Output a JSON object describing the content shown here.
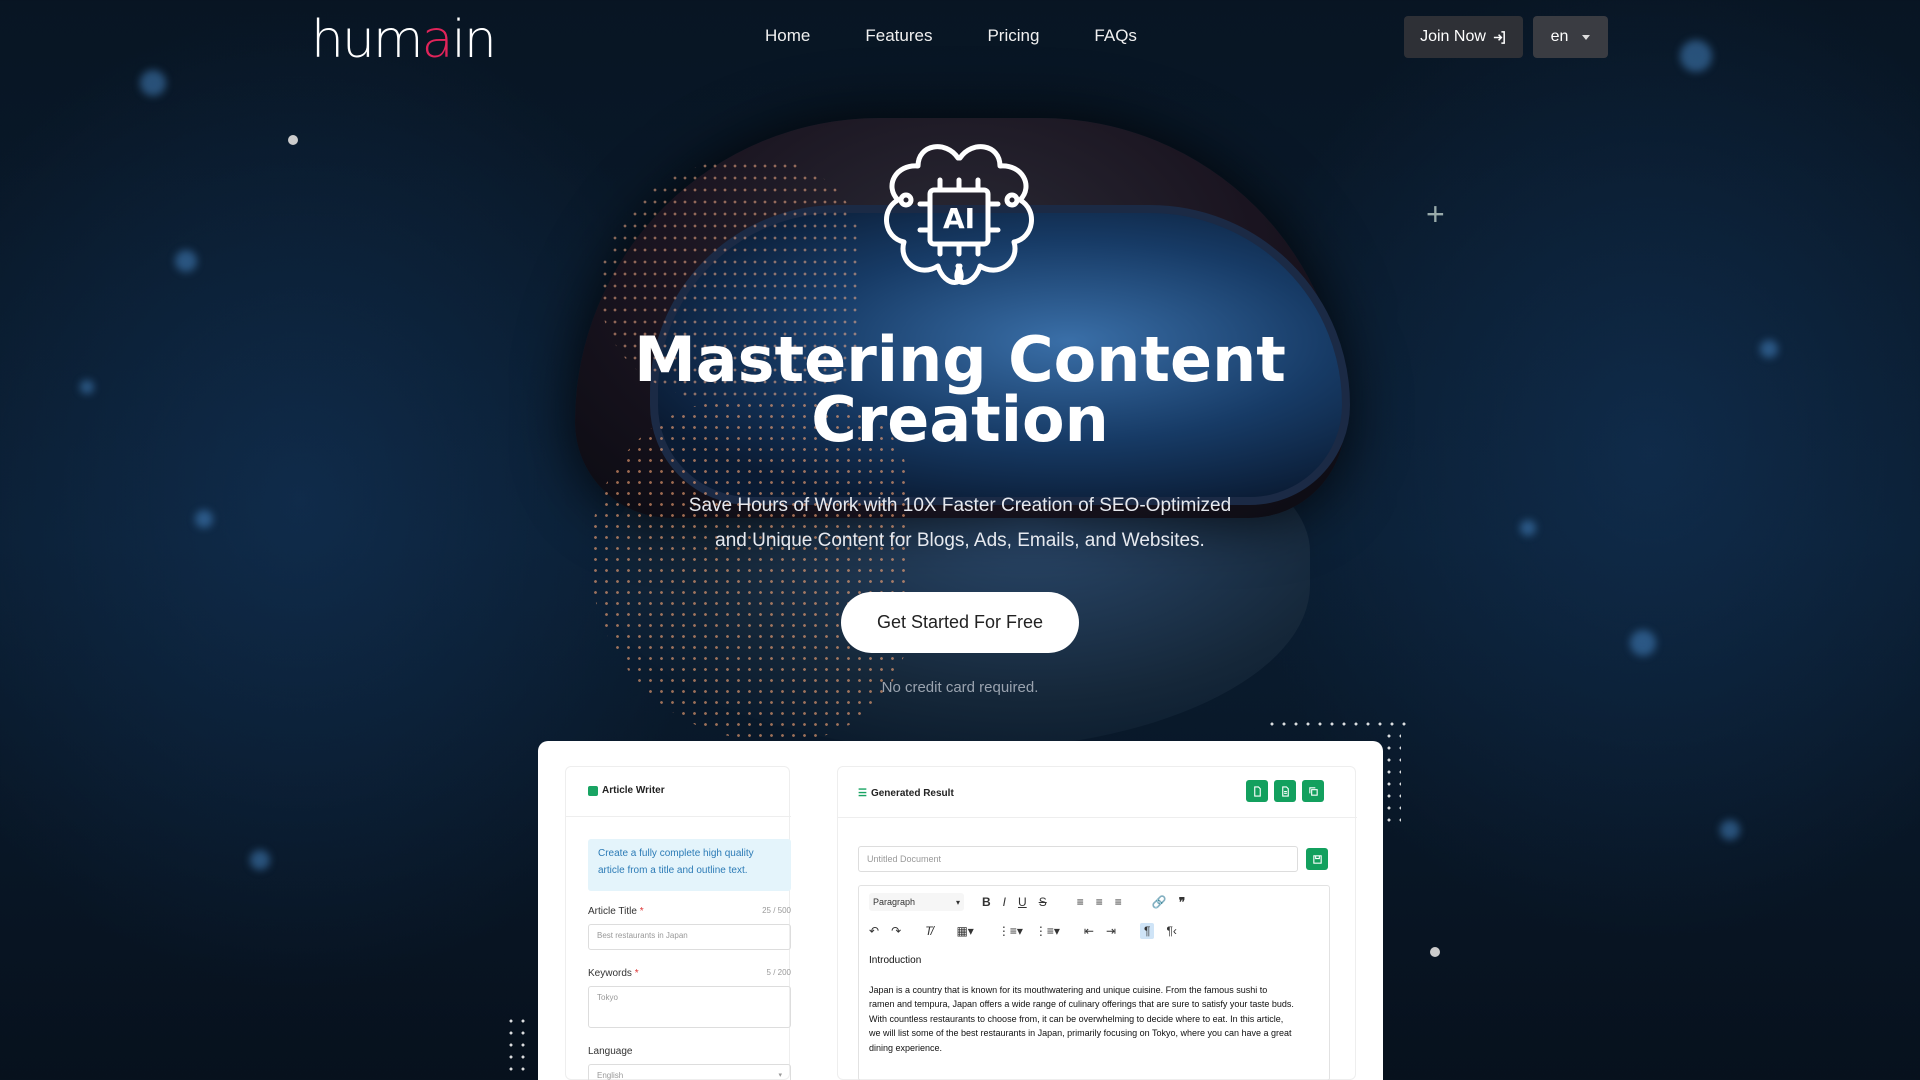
{
  "brand": {
    "logo_prefix": "hum",
    "logo_accent": "a",
    "logo_suffix": "in"
  },
  "nav": {
    "links": [
      "Home",
      "Features",
      "Pricing",
      "FAQs"
    ],
    "join_label": "Join Now",
    "lang_label": "en"
  },
  "hero": {
    "title_line1": "Mastering Content",
    "title_line2": "Creation",
    "subtitle_line1": "Save Hours of Work with 10X Faster Creation of SEO-Optimized",
    "subtitle_line2": "and Unique Content for Blogs, Ads, Emails, and Websites.",
    "cta_label": "Get Started For Free",
    "note": "No credit card required.",
    "icon_text": "AI"
  },
  "app": {
    "left": {
      "title": "Article Writer",
      "info_line1": "Create a fully complete high quality",
      "info_line2": "article from a title and outline text.",
      "article_title_label": "Article Title",
      "article_title_counter": "25 / 500",
      "article_title_value": "Best restaurants in Japan",
      "keywords_label": "Keywords",
      "keywords_counter": "5 / 200",
      "keywords_value": "Tokyo",
      "language_label": "Language",
      "language_value": "English",
      "required_mark": "*"
    },
    "right": {
      "title": "Generated Result",
      "doc_placeholder": "Untitled Document",
      "block_format": "Paragraph",
      "heading": "Introduction",
      "body_lines": [
        "Japan is a country that is known for its mouthwatering and unique cuisine. From the famous sushi to",
        "ramen and tempura, Japan offers a wide range of culinary offerings that are sure to satisfy your taste buds.",
        "With countless restaurants to choose from, it can be overwhelming to decide where to eat. In this article,",
        "we will list some of the best restaurants in Japan, primarily focusing on Tokyo, where you can have a great",
        "dining experience."
      ]
    }
  },
  "colors": {
    "accent": "#e0245a",
    "green": "#13a05e",
    "info_bg": "#e4f4fb",
    "info_text": "#2c7bb6"
  }
}
